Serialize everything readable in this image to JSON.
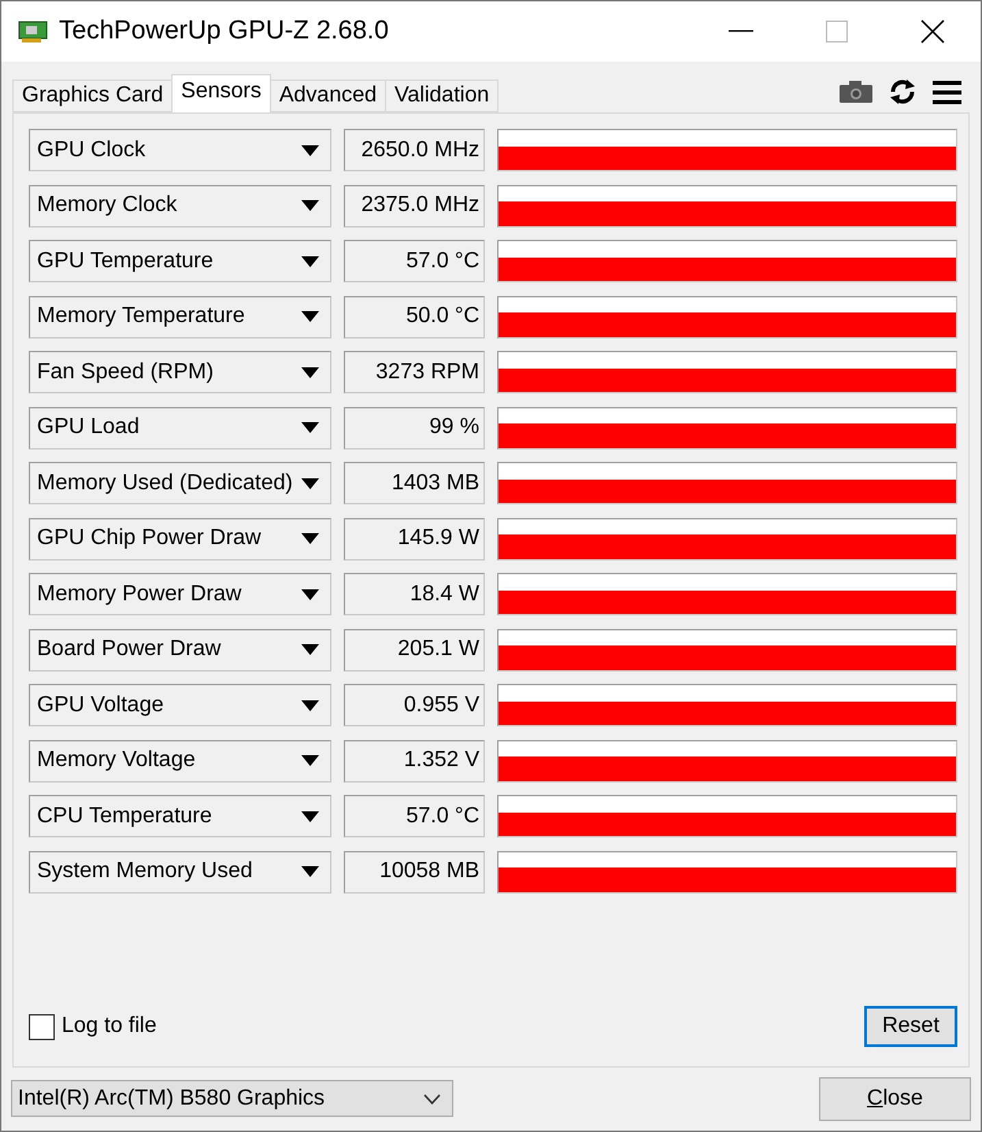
{
  "window": {
    "title": "TechPowerUp GPU-Z 2.68.0"
  },
  "tabs": [
    {
      "label": "Graphics Card",
      "selected": false
    },
    {
      "label": "Sensors",
      "selected": true
    },
    {
      "label": "Advanced",
      "selected": false
    },
    {
      "label": "Validation",
      "selected": false
    }
  ],
  "sensors": [
    {
      "name": "GPU Clock",
      "value": "2650.0 MHz"
    },
    {
      "name": "Memory Clock",
      "value": "2375.0 MHz"
    },
    {
      "name": "GPU Temperature",
      "value": "57.0 °C"
    },
    {
      "name": "Memory Temperature",
      "value": "50.0 °C"
    },
    {
      "name": "Fan Speed (RPM)",
      "value": "3273 RPM"
    },
    {
      "name": "GPU Load",
      "value": "99 %"
    },
    {
      "name": "Memory Used (Dedicated)",
      "value": "1403 MB"
    },
    {
      "name": "GPU Chip Power Draw",
      "value": "145.9 W"
    },
    {
      "name": "Memory Power Draw",
      "value": "18.4 W"
    },
    {
      "name": "Board Power Draw",
      "value": "205.1 W"
    },
    {
      "name": "GPU Voltage",
      "value": "0.955 V"
    },
    {
      "name": "Memory Voltage",
      "value": "1.352 V"
    },
    {
      "name": "CPU Temperature",
      "value": "57.0 °C"
    },
    {
      "name": "System Memory Used",
      "value": "10058 MB"
    }
  ],
  "log_to_file": {
    "label": "Log to file",
    "checked": false
  },
  "reset_button": "Reset",
  "device_select": {
    "value": "Intel(R) Arc(TM) B580 Graphics"
  },
  "close_button": "Close"
}
